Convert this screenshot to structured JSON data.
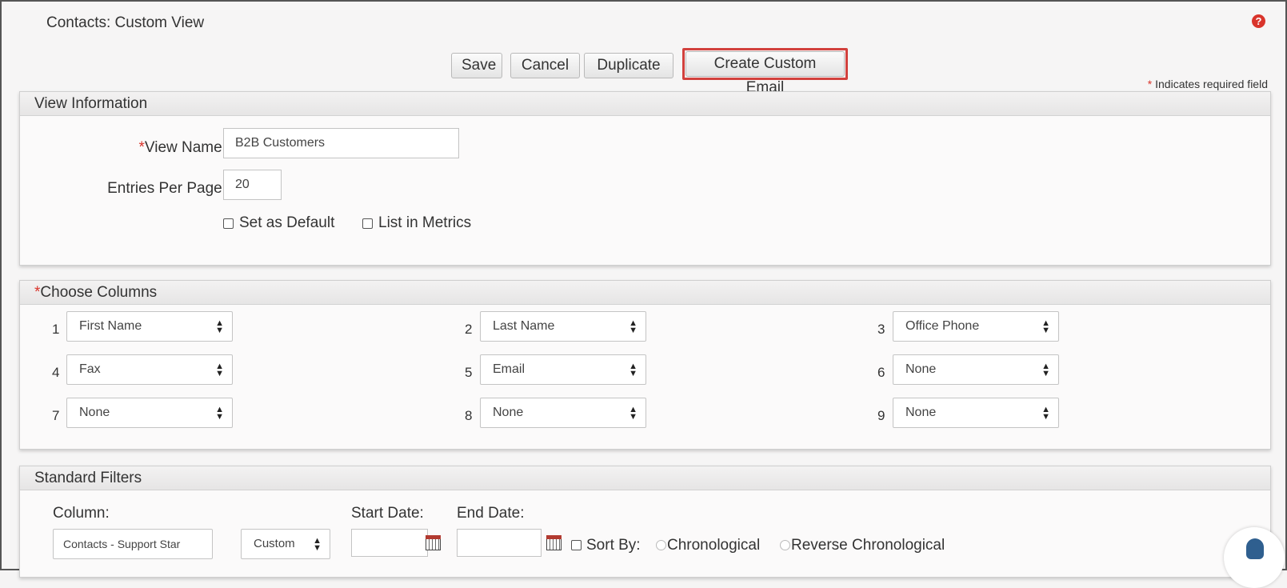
{
  "page": {
    "title": "Contacts: Custom View",
    "help_icon": "?"
  },
  "toolbar": {
    "save": "Save",
    "cancel": "Cancel",
    "duplicate": "Duplicate",
    "create_custom_email": "Create Custom Email"
  },
  "required_note": {
    "star": "*",
    "text": " Indicates required field"
  },
  "view_info": {
    "header": "View Information",
    "view_name_label": "View Name:",
    "view_name_value": "B2B Customers",
    "entries_label": "Entries Per Page:",
    "entries_value": "20",
    "set_default": "Set as Default",
    "list_metrics": "List in Metrics"
  },
  "columns": {
    "header": "Choose Columns",
    "items": [
      {
        "num": "1",
        "value": "First Name"
      },
      {
        "num": "2",
        "value": "Last Name"
      },
      {
        "num": "3",
        "value": "Office Phone"
      },
      {
        "num": "4",
        "value": "Fax"
      },
      {
        "num": "5",
        "value": "Email"
      },
      {
        "num": "6",
        "value": "None"
      },
      {
        "num": "7",
        "value": "None"
      },
      {
        "num": "8",
        "value": "None"
      },
      {
        "num": "9",
        "value": "None"
      }
    ]
  },
  "filters": {
    "header": "Standard Filters",
    "column_label": "Column:",
    "start_label": "Start Date:",
    "end_label": "End Date:",
    "column_value": "Contacts - Support Star",
    "range_value": "Custom",
    "start_value": "",
    "end_value": "",
    "sort_label": "Sort By:",
    "sort_chrono": "Chronological",
    "sort_reverse": "Reverse Chronological"
  }
}
